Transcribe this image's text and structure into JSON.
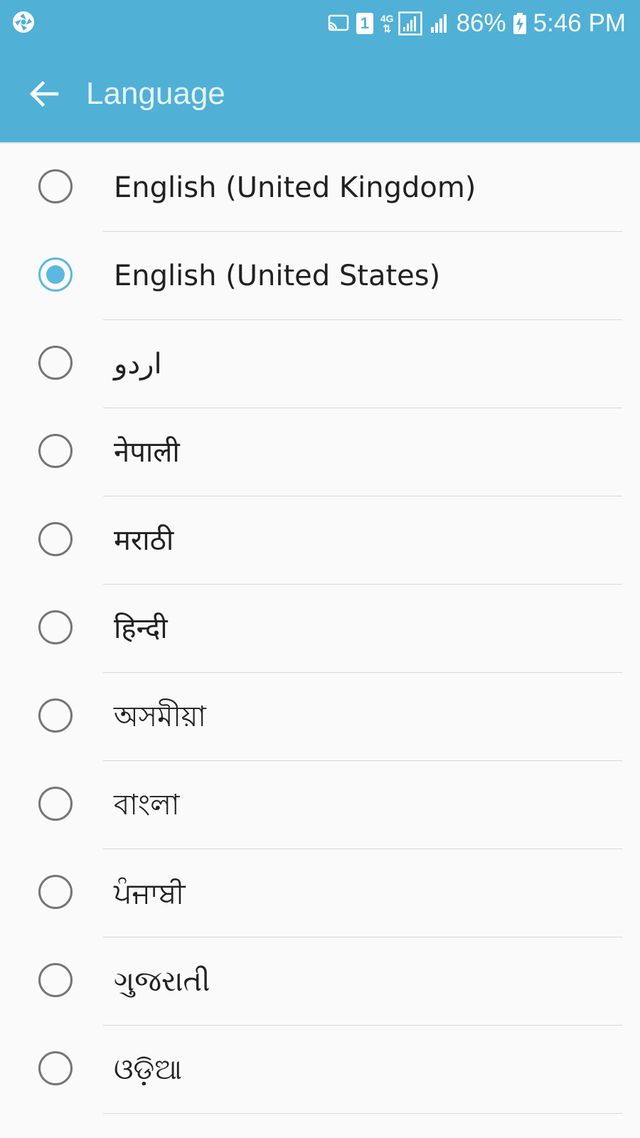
{
  "status_bar": {
    "icons": [
      "camera-aperture-icon",
      "cast-icon",
      "sim-1-icon",
      "lte-4g-icon",
      "signal-sim1-icon",
      "signal-sim2-icon",
      "battery-charging-icon"
    ],
    "network_type": "4G",
    "sim_label": "1",
    "battery": "86%",
    "time": "5:46 PM"
  },
  "toolbar": {
    "back_icon": "arrow-left-icon",
    "title": "Language"
  },
  "colors": {
    "appbar": "#50b0d6",
    "accent": "#5bb8e0",
    "background": "#fafafa",
    "text": "#212121"
  },
  "languages": [
    {
      "label": "English (United Kingdom)",
      "selected": false
    },
    {
      "label": "English (United States)",
      "selected": true
    },
    {
      "label": "اردو",
      "selected": false
    },
    {
      "label": "नेपाली",
      "selected": false
    },
    {
      "label": "मराठी",
      "selected": false
    },
    {
      "label": "हिन्दी",
      "selected": false
    },
    {
      "label": "অসমীয়া",
      "selected": false
    },
    {
      "label": "বাংলা",
      "selected": false
    },
    {
      "label": "ਪੰਜਾਬੀ",
      "selected": false
    },
    {
      "label": "ગુજરાતી",
      "selected": false
    },
    {
      "label": "ଓଡ଼ିଆ",
      "selected": false
    }
  ]
}
